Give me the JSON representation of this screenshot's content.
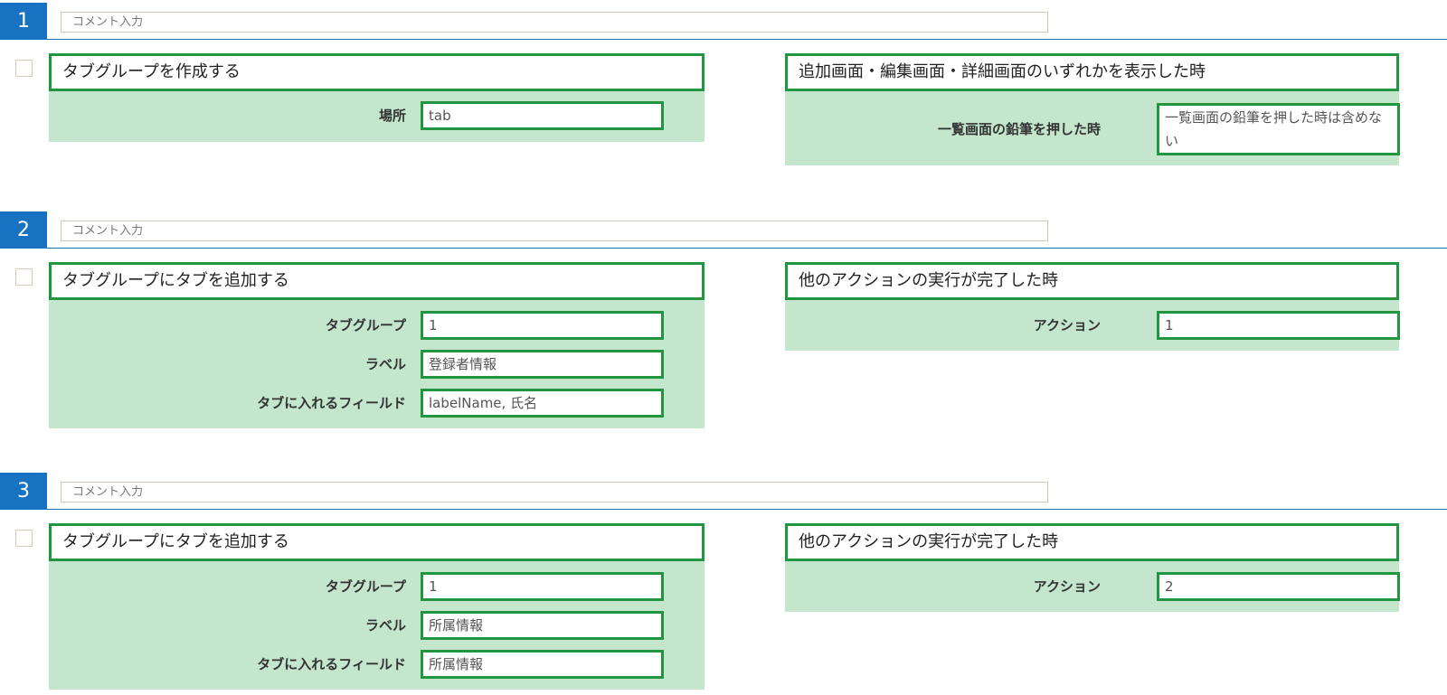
{
  "steps": [
    {
      "number": "1",
      "comment_placeholder": "コメント入力",
      "action": {
        "title": "タブグループを作成する",
        "fields": [
          {
            "label": "場所",
            "value": "tab"
          }
        ]
      },
      "trigger": {
        "title": "追加画面・編集画面・詳細画面のいずれかを表示した時",
        "fields": [
          {
            "label": "一覧画面の鉛筆を押した時",
            "value": "一覧画面の鉛筆を押した時は含めない"
          }
        ]
      }
    },
    {
      "number": "2",
      "comment_placeholder": "コメント入力",
      "action": {
        "title": "タブグループにタブを追加する",
        "fields": [
          {
            "label": "タブグループ",
            "value": "1"
          },
          {
            "label": "ラベル",
            "value": "登録者情報"
          },
          {
            "label": "タブに入れるフィールド",
            "value": "labelName, 氏名"
          }
        ]
      },
      "trigger": {
        "title": "他のアクションの実行が完了した時",
        "fields": [
          {
            "label": "アクション",
            "value": "1"
          }
        ]
      }
    },
    {
      "number": "3",
      "comment_placeholder": "コメント入力",
      "action": {
        "title": "タブグループにタブを追加する",
        "fields": [
          {
            "label": "タブグループ",
            "value": "1"
          },
          {
            "label": "ラベル",
            "value": "所属情報"
          },
          {
            "label": "タブに入れるフィールド",
            "value": "所属情報"
          }
        ]
      },
      "trigger": {
        "title": "他のアクションの実行が完了した時",
        "fields": [
          {
            "label": "アクション",
            "value": "2"
          }
        ]
      }
    }
  ],
  "colors": {
    "step_number_bg": "#1772c2",
    "panel_bg": "#c4e6cd",
    "panel_border": "#22953f",
    "header_rule": "#1d72b8",
    "comment_border": "#d6c6b4",
    "checkbox_border": "#e1c7b4"
  }
}
